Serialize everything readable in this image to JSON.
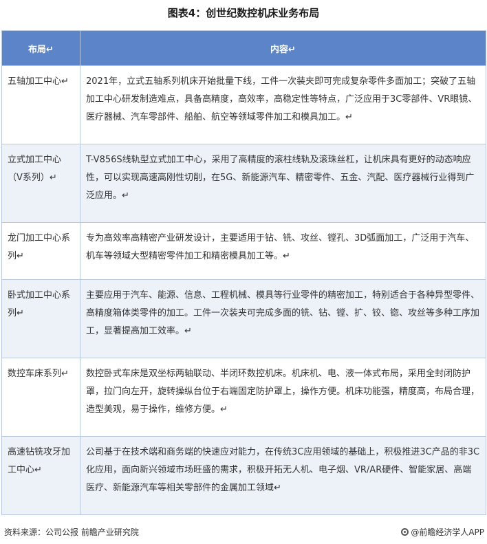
{
  "title": "图表4：创世纪数控机床业务布局",
  "table": {
    "headers": {
      "layout": "布局↵",
      "content": "内容↵"
    },
    "rows": [
      {
        "layout": "五轴加工中心↵",
        "content": "2021年，立式五轴系列机床开始批量下线，工件一次装夹即可完成复杂零件多面加工；突破了五轴加工中心研发制造难点，具备高精度，高效率，高稳定性等特点，广泛应用于3C零部件、VR眼镜、医疗器械、汽车零部件、船舶、航空等领域零件加工和模具加工。↵"
      },
      {
        "layout": "立式加工中心（V系列）↵",
        "content": "T-V856S线轨型立式加工中心，采用了高精度的滚柱线轨及滚珠丝杠，让机床具有更好的动态响应性，可以实现高速高刚性切削，在5G、新能源汽车、精密零件、五金、汽配、医疗器械行业得到广泛应用。↵"
      },
      {
        "layout": "龙门加工中心系列↵",
        "content": "专为高效率高精密产业研发设计，主要适用于钻、铣、攻丝、镗孔、3D弧面加工，广泛用于汽车、机车等领域大型精密零件加工和精密模具加工等。↵"
      },
      {
        "layout": "卧式加工中心系列↵",
        "content": "主要应用于汽车、能源、信息、工程机械、模具等行业零件的精密加工，特别适合于各种异型零件、高精度箱体类零件的加工。工件一次装夹可完成多面的铣、钻、镗、扩、铰、锪、攻丝等多种工序加工，显著提高加工效率。↵"
      },
      {
        "layout": "数控车床系列↵",
        "content": "数控卧式车床是双坐标两轴联动、半闭环数控机床。机床机、电、液一体式布局，采用全封闭防护罩，拉门向左开，旋转操纵台位于右端固定防护罩上，操作方便。机床功能强，精度高，布局合理，造型美观，易于操作，维修方便。↵"
      },
      {
        "layout": "高速钻铣攻牙加工中心↵",
        "content": "公司基于在技术端和商务端的快速应对能力，在传统3C应用领域的基础上，积极推进3C产品的非3C化应用，面向新兴领域市场旺盛的需求，积极开拓无人机、电子烟、VR/AR硬件、智能家居、高端医疗、新能源汽车等相关零部件的金属加工领域↵"
      }
    ]
  },
  "footer": {
    "source": "资料来源：公司公报 前瞻产业研究院",
    "brand": "@前瞻经济学人APP",
    "brand_icon": "circle-logo-icon"
  }
}
